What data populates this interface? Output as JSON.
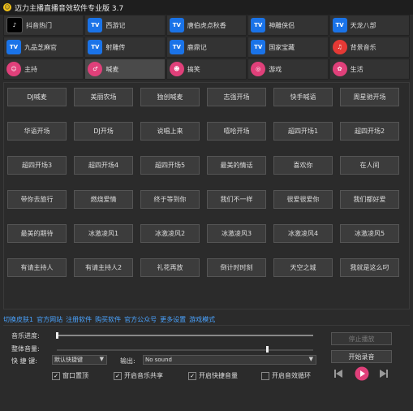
{
  "window": {
    "title": "迈力主播直播音效软件专业版 3.7"
  },
  "categories": [
    {
      "label": "抖音热门",
      "icon": "tiktok-icon",
      "kind": "tiktok",
      "glyph": "♪"
    },
    {
      "label": "西游记",
      "icon": "tv-icon",
      "kind": "tv",
      "glyph": "TV"
    },
    {
      "label": "唐伯虎点秋香",
      "icon": "tv-icon",
      "kind": "tv",
      "glyph": "TV"
    },
    {
      "label": "神雕侠侣",
      "icon": "tv-icon",
      "kind": "tv",
      "glyph": "TV"
    },
    {
      "label": "天龙八部",
      "icon": "tv-icon",
      "kind": "tv",
      "glyph": "TV"
    },
    {
      "label": "九品芝麻官",
      "icon": "tv-icon",
      "kind": "tv",
      "glyph": "TV"
    },
    {
      "label": "射雕传",
      "icon": "tv-icon",
      "kind": "tv",
      "glyph": "TV"
    },
    {
      "label": "鹿鼎记",
      "icon": "tv-icon",
      "kind": "tv",
      "glyph": "TV"
    },
    {
      "label": "国家宝藏",
      "icon": "tv-icon",
      "kind": "tv",
      "glyph": "TV"
    },
    {
      "label": "背景音乐",
      "icon": "music-note-icon",
      "kind": "redmusic",
      "glyph": "♫"
    },
    {
      "label": "主持",
      "icon": "person-icon",
      "kind": "pink",
      "glyph": "☺"
    },
    {
      "label": "喊麦",
      "icon": "microphone-icon",
      "kind": "pink",
      "glyph": "♂"
    },
    {
      "label": "搞笑",
      "icon": "laugh-icon",
      "kind": "pink",
      "glyph": "☻"
    },
    {
      "label": "游戏",
      "icon": "gamepad-icon",
      "kind": "pink",
      "glyph": "◎"
    },
    {
      "label": "生活",
      "icon": "cake-icon",
      "kind": "pink",
      "glyph": "✿"
    }
  ],
  "active_category": 11,
  "sound_buttons": [
    "DJ喊麦",
    "美丽农场",
    "独创喊麦",
    "志强开场",
    "快手喊语",
    "周星驰开场",
    "华语开场",
    "DJ开场",
    "说唱上来",
    "嘻哈开场",
    "超四开场1",
    "超四开场2",
    "超四开场3",
    "超四开场4",
    "超四开场5",
    "最美的情话",
    "喜欢你",
    "在人间",
    "带你去旅行",
    "燃烧爱情",
    "终于等到你",
    "我们不一样",
    "很爱很爱你",
    "我们都好爱",
    "最美的期待",
    "冰激凌风1",
    "冰激凌风2",
    "冰激凌风3",
    "冰激凌风4",
    "冰激凌风5",
    "有请主持人",
    "有请主持人2",
    "礼花再放",
    "倒计时时刻",
    "天空之城",
    "我就是这么叼"
  ],
  "links": [
    "切换皮肤1",
    "官方网站",
    "注册软件",
    "购买软件",
    "官方公众号",
    "更多设置",
    "游戏模式"
  ],
  "controls": {
    "music_progress_label": "音乐进度:",
    "music_progress_value": 0.0,
    "volume_label": "整体音量:",
    "volume_value": 0.82,
    "hotkey_label": "快 捷 键:",
    "hotkey_value": "默认快捷键",
    "output_label": "输出:",
    "output_value": "No sound",
    "checkboxes": [
      {
        "label": "窗口置顶",
        "checked": true
      },
      {
        "label": "开启音乐共享",
        "checked": true
      },
      {
        "label": "开启快捷音量",
        "checked": true
      },
      {
        "label": "开启音效循环",
        "checked": false
      }
    ],
    "stop_button": "停止播放",
    "start_button": "开始录音"
  },
  "colors": {
    "accent": "#e0407a",
    "link": "#4aa3ff",
    "tv": "#1a73e8"
  }
}
